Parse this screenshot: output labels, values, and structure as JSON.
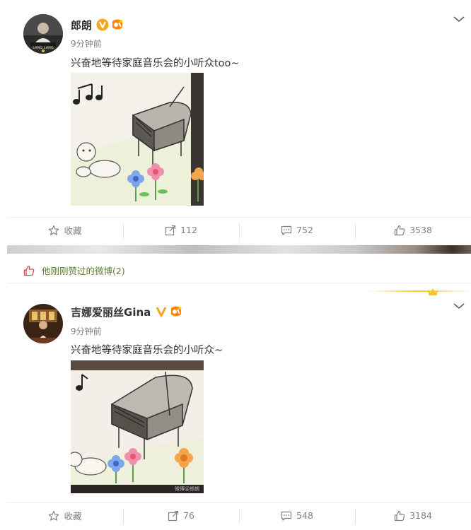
{
  "posts": [
    {
      "username": "郎朗",
      "time": "9分钟前",
      "text": "兴奋地等待家庭音乐会的小听众too~",
      "avatar_text": "LANG LANG",
      "actions": {
        "favorite_label": "收藏",
        "repost_count": "112",
        "comment_count": "752",
        "like_count": "3538"
      }
    },
    {
      "username": "吉娜爱丽丝Gina",
      "time": "9分钟前",
      "text": "兴奋地等待家庭音乐会的小听众~",
      "watermark": "微博@郎朗",
      "actions": {
        "favorite_label": "收藏",
        "repost_count": "76",
        "comment_count": "548",
        "like_count": "3184"
      }
    }
  ],
  "liked_notice": "他刚刚赞过的微博(2)",
  "colors": {
    "verified_badge": "#f5a623",
    "liked_green": "#5d7d35",
    "like_icon": "#e0434d",
    "level_badge": "#ff8200"
  },
  "icons": [
    "star-icon",
    "repost-icon",
    "comment-icon",
    "thumbs-up-icon",
    "chevron-down-icon",
    "verified-icon",
    "level-badge-icon",
    "crown-icon"
  ]
}
